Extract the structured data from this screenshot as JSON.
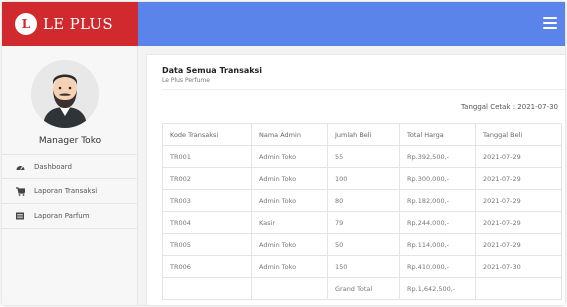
{
  "brand": {
    "icon_letter": "L",
    "name": "LE PLUS",
    "color": "#d12a2e"
  },
  "topbar": {
    "color": "#5b84ea",
    "menu_icon": "hamburger-icon"
  },
  "sidebar": {
    "user_name": "Manager Toko",
    "items": [
      {
        "label": "Dashboard",
        "icon": "dashboard-icon"
      },
      {
        "label": "Laporan Transaksi",
        "icon": "cart-icon"
      },
      {
        "label": "Laporan Parfum",
        "icon": "list-icon"
      }
    ]
  },
  "main": {
    "title": "Data Semua Transaksi",
    "subtitle": "Le Plus Perfume",
    "print_date": "Tanggal Cetak : 2021-07-30",
    "table": {
      "headers": [
        "Kode Transaksi",
        "Nama Admin",
        "Jumlah Beli",
        "Total Harga",
        "Tanggal Beli"
      ],
      "rows": [
        [
          "TR001",
          "Admin Toko",
          "55",
          "Rp.392,500,-",
          "2021-07-29"
        ],
        [
          "TR002",
          "Admin Toko",
          "100",
          "Rp.300,000,-",
          "2021-07-29"
        ],
        [
          "TR003",
          "Admin Toko",
          "80",
          "Rp.182,000,-",
          "2021-07-29"
        ],
        [
          "TR004",
          "Kasir",
          "79",
          "Rp.244,000,-",
          "2021-07-29"
        ],
        [
          "TR005",
          "Admin Toko",
          "50",
          "Rp.114,000,-",
          "2021-07-29"
        ],
        [
          "TR006",
          "Admin Toko",
          "150",
          "Rp.410,000,-",
          "2021-07-30"
        ]
      ],
      "footer": [
        "",
        "",
        "Grand Total",
        "Rp.1,642,500,-",
        ""
      ]
    }
  }
}
